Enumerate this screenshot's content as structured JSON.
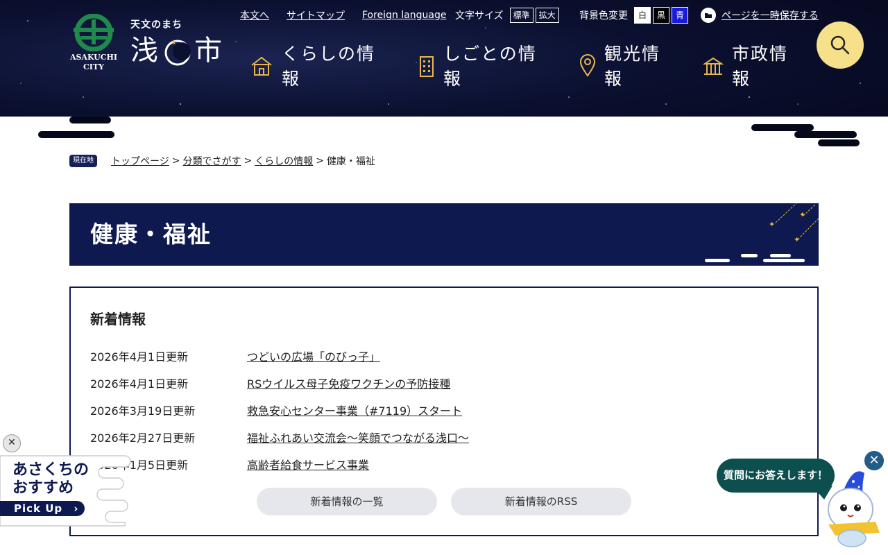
{
  "header": {
    "logo": {
      "subtitle": "天文のまち",
      "name_left": "浅",
      "name_right": "市",
      "city_en_1": "ASAKUCHI",
      "city_en_2": "CITY"
    },
    "utility": {
      "skip_link": "本文へ",
      "sitemap": "サイトマップ",
      "foreign": "Foreign language",
      "text_size_label": "文字サイズ",
      "size_standard": "標準",
      "size_large": "拡大",
      "bg_label": "背景色変更",
      "bg_white": "白",
      "bg_black": "黒",
      "bg_blue": "青",
      "save_page": "ページを一時保存する"
    },
    "nav": [
      {
        "label_1": "くらしの情",
        "label_2": "報",
        "icon": "house-icon"
      },
      {
        "label_1": "しごとの情",
        "label_2": "報",
        "icon": "building-icon"
      },
      {
        "label_1": "観光情",
        "label_2": "報",
        "icon": "map-pin-icon"
      },
      {
        "label_1": "市政情",
        "label_2": "報",
        "icon": "city-hall-icon"
      }
    ],
    "search_icon": "search-icon",
    "colors": {
      "night": "#05071a",
      "accent_gold": "#e8b64a",
      "search_bg": "#f7e08a"
    }
  },
  "breadcrumb": {
    "badge": "現在地",
    "items": [
      "トップページ",
      "分類でさがす",
      "くらしの情報"
    ],
    "current": "健康・福祉",
    "separator": ">"
  },
  "page": {
    "title": "健康・福祉",
    "banner_color": "#0e1950"
  },
  "news": {
    "heading": "新着情報",
    "items": [
      {
        "date": "2026年4月1日更新",
        "title": "つどいの広場「のびっ子」"
      },
      {
        "date": "2026年4月1日更新",
        "title": "RSウイルス母子免疫ワクチンの予防接種"
      },
      {
        "date": "2026年3月19日更新",
        "title": "救急安心センター事業（#7119）スタート"
      },
      {
        "date": "2026年2月27日更新",
        "title": "福祉ふれあい交流会～笑顔でつながる浅口～"
      },
      {
        "date": "2026年1月5日更新",
        "title": "高齢者給食サービス事業"
      }
    ],
    "list_button": "新着情報の一覧",
    "rss_button": "新着情報のRSS"
  },
  "pickup": {
    "close": "✕",
    "line1": "あさくちの",
    "line2": "おすすめ",
    "button": "Pick Up",
    "arrow": "›"
  },
  "chatbot": {
    "bubble": "質問にお答えします！",
    "close": "✕"
  }
}
